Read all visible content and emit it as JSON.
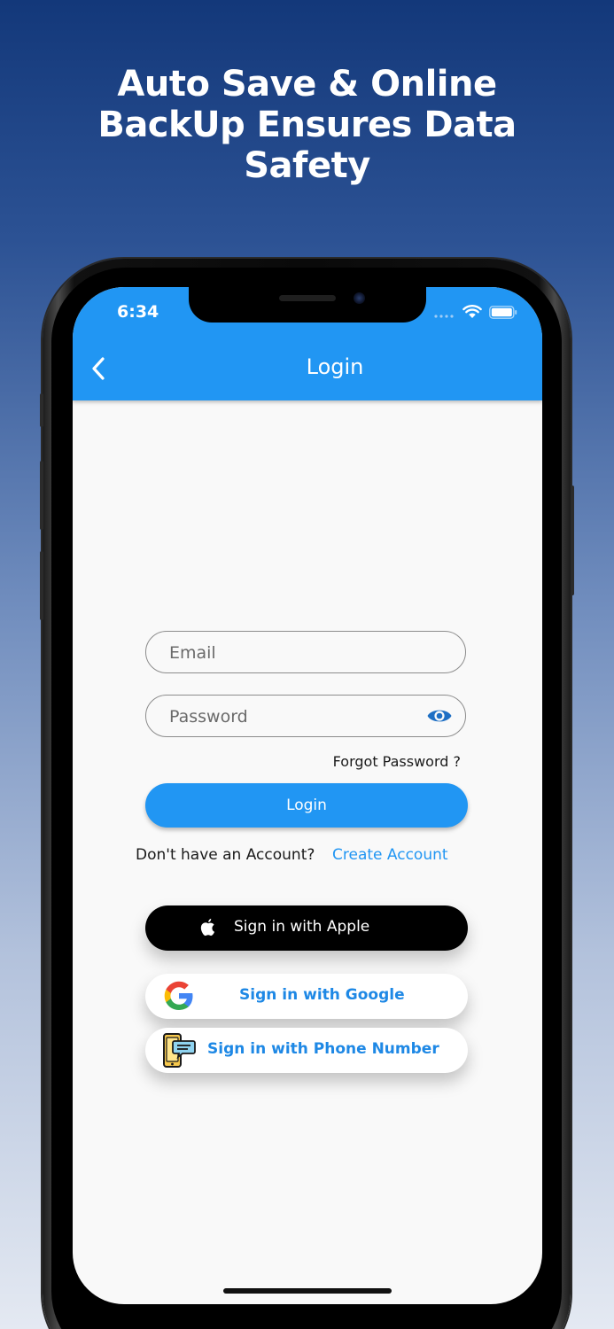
{
  "promo": {
    "line1": "Auto Save & Online",
    "line2": "BackUp Ensures Data",
    "line3": "Safety"
  },
  "status_bar": {
    "time": "6:34"
  },
  "header": {
    "title": "Login"
  },
  "form": {
    "email_placeholder": "Email",
    "password_placeholder": "Password",
    "forgot_password": "Forgot Password ?",
    "login_label": "Login",
    "account_prompt": "Don't have an Account?",
    "create_account": "Create Account"
  },
  "social": {
    "apple_label": "Sign in with Apple",
    "google_label": "Sign in with Google",
    "phone_label": "Sign in with Phone Number"
  },
  "icons": {
    "back": "chevron-left-icon",
    "eye": "eye-icon",
    "apple": "apple-logo-icon",
    "google": "google-logo-icon",
    "phone": "phone-message-icon",
    "wifi": "wifi-icon",
    "battery": "battery-icon",
    "signal": "signal-icon"
  },
  "colors": {
    "primary": "#2196f3",
    "link": "#1e88e5",
    "apple_button": "#000000",
    "screen_background": "#f9f9f9"
  }
}
